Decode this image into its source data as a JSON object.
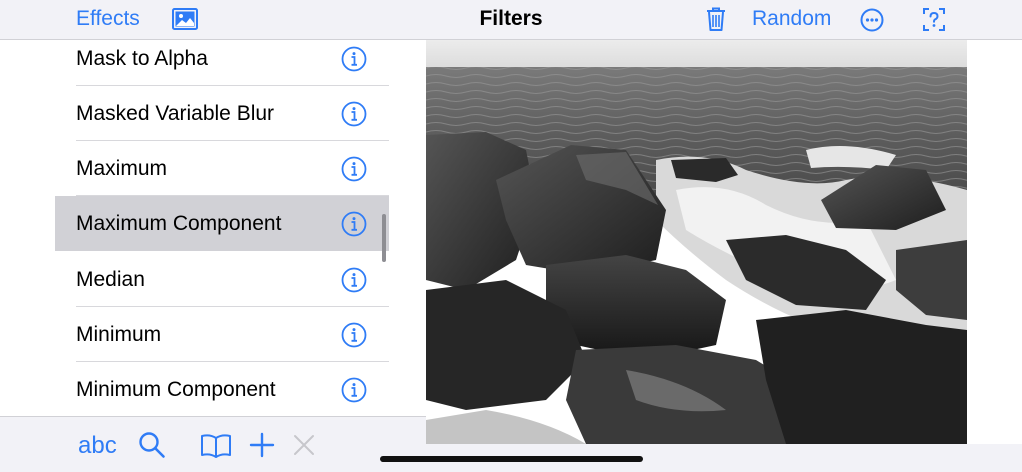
{
  "toolbar": {
    "effects_label": "Effects",
    "title": "Filters",
    "random_label": "Random",
    "accent_color": "#2f7cf6",
    "icons": [
      "photo-icon",
      "trash-icon",
      "more-icon",
      "help-icon"
    ]
  },
  "filters": [
    {
      "label": "Mask to Alpha",
      "selected": false
    },
    {
      "label": "Masked Variable Blur",
      "selected": false
    },
    {
      "label": "Maximum",
      "selected": false
    },
    {
      "label": "Maximum Component",
      "selected": true
    },
    {
      "label": "Median",
      "selected": false
    },
    {
      "label": "Minimum",
      "selected": false
    },
    {
      "label": "Minimum Component",
      "selected": false
    }
  ],
  "bottom_toolbar": {
    "abc_label": "abc",
    "icons": [
      "search-icon",
      "book-icon",
      "plus-icon",
      "close-icon"
    ]
  },
  "preview": {
    "description_icon": "photo-preview"
  }
}
